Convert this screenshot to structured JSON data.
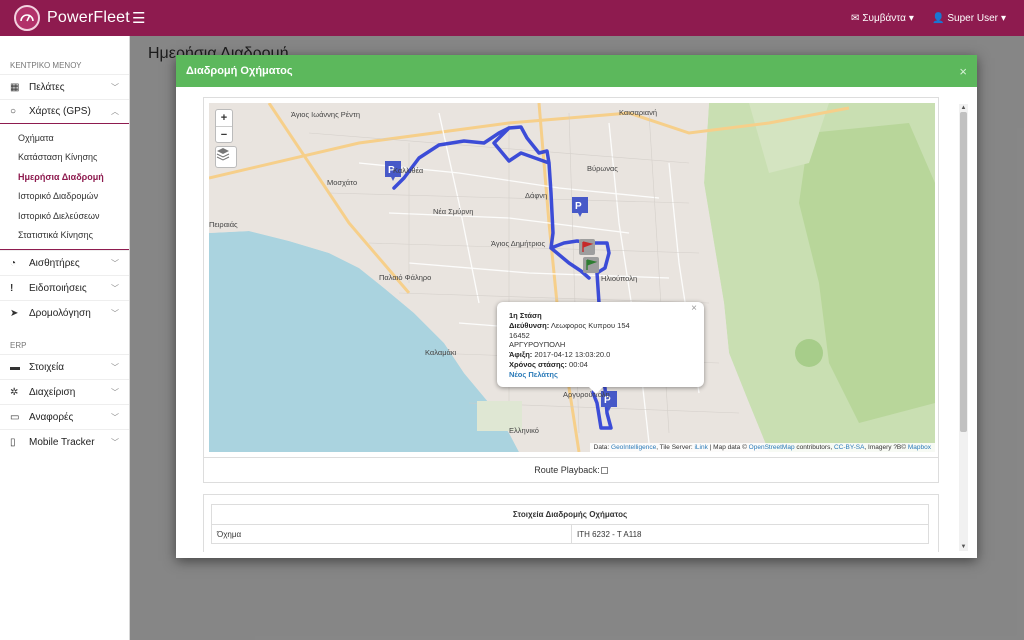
{
  "app": {
    "brand": "PowerFleet",
    "menu_icon": "hamburger-icon"
  },
  "topbar": {
    "agreements_label": "Συμβάντα",
    "user_label": "Super User"
  },
  "sidebar": {
    "main_section": "ΚΕΝΤΡΙΚΟ ΜΕΝΟΥ",
    "erp_section": "ERP",
    "items": [
      {
        "label": "Πελάτες",
        "icon": "map-icon"
      },
      {
        "label": "Χάρτες (GPS)",
        "icon": "globe-icon"
      },
      {
        "label": "Αισθητήρες",
        "icon": "gauge-icon"
      },
      {
        "label": "Ειδοποιήσεις",
        "icon": "alert-icon"
      },
      {
        "label": "Δρομολόγηση",
        "icon": "route-icon"
      }
    ],
    "sub_items": [
      {
        "label": "Οχήματα"
      },
      {
        "label": "Κατάσταση Κίνησης"
      },
      {
        "label": "Ημερήσια Διαδρομή"
      },
      {
        "label": "Ιστορικό Διαδρομών"
      },
      {
        "label": "Ιστορικό Διελεύσεων"
      },
      {
        "label": "Στατιστικά Κίνησης"
      }
    ],
    "erp_items": [
      {
        "label": "Στοιχεία",
        "icon": "truck-icon"
      },
      {
        "label": "Διαχείριση",
        "icon": "cog-icon"
      },
      {
        "label": "Αναφορές",
        "icon": "monitor-icon"
      },
      {
        "label": "Mobile Tracker",
        "icon": "mobile-icon"
      }
    ]
  },
  "page": {
    "title": "Ημερήσια Διαδρομή"
  },
  "modal": {
    "title": "Διαδρομή Οχήματος",
    "close": "×",
    "popup": {
      "title": "1η Στάση",
      "address_label": "Διεύθυνση:",
      "address_value": "Λεωφορος Κυπρου 154",
      "postal_code": "16452",
      "area": "ΑΡΓΥΡΟΥΠΟΛΗ",
      "arrival_label": "Άφιξη:",
      "arrival_value": "2017-04-12 13:03:20.0",
      "stop_time_label": "Χρόνος στάσης:",
      "stop_time_value": "00:04",
      "new_customer_link": "Νέος Πελάτης"
    },
    "map_labels": {
      "n1": "Άγιος Ιωάννης Ρέντη",
      "n2": "Καλλιθέα",
      "n3": "Μοσχάτο",
      "n4": "Νέα Σμύρνη",
      "n5": "Πειραιάς",
      "n6": "Παλαιό Φάληρο",
      "n7": "Άγιος Δημήτριος",
      "n8": "Δάφνη",
      "n9": "Βύρωνας",
      "n10": "Καισαριανή",
      "n11": "Ηλιούπολη",
      "n12": "Καλαμάκι",
      "n13": "Αργυρούπολη",
      "n14": "Ελληνικό"
    },
    "attribution": {
      "prefix": "Data: ",
      "l1": "GeoIntelligence",
      "mid1": ", Tile Server: ",
      "l2": "iLink",
      "mid2": " | Map data © ",
      "l3": "OpenStreetMap",
      "mid3": " contributors, ",
      "l4": "CC-BY-SA",
      "mid4": ", Imagery ?B© ",
      "l5": "Mapbox"
    },
    "playback_label": "Route Playback:",
    "details": {
      "header": "Στοιχεία Διαδρομής Οχήματος",
      "rows": [
        {
          "key": "Όχημα",
          "value": "ΙΤΗ 6232 - Τ Α118"
        }
      ]
    }
  },
  "colors": {
    "brand": "#8e1b4f",
    "modal_header": "#5cb85c",
    "route": "#2d3fd6"
  }
}
